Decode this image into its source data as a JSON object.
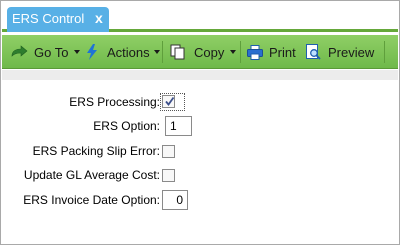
{
  "tab": {
    "title": "ERS Control",
    "close_glyph": "x"
  },
  "toolbar": {
    "goto_label": "Go To",
    "actions_label": "Actions",
    "copy_label": "Copy",
    "print_label": "Print",
    "preview_label": "Preview"
  },
  "form": {
    "ers_processing": {
      "label": "ERS Processing:",
      "checked": true
    },
    "ers_option": {
      "label": "ERS Option:",
      "value": "1"
    },
    "packing_slip_error": {
      "label": "ERS Packing Slip Error:",
      "checked": false
    },
    "update_gl_cost": {
      "label": "Update GL Average Cost:",
      "checked": false
    },
    "invoice_date_option": {
      "label": "ERS Invoice Date Option:",
      "value": "0"
    }
  },
  "colors": {
    "tab": "#58b0e6",
    "toolbar": "#7cc454",
    "accent_line": "#65a83a"
  },
  "icons": [
    "goto-arrow-icon",
    "lightning-icon",
    "copy-icon",
    "print-icon",
    "preview-icon"
  ]
}
